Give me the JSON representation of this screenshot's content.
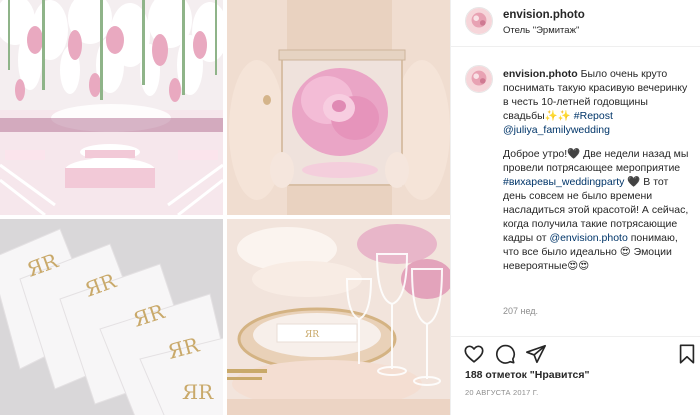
{
  "post": {
    "username": "envision.photo",
    "location": "Отель \"Эрмитаж\""
  },
  "caption": {
    "username": "envision.photo",
    "text_1": "Было очень круто поснимать такую красивую вечеринку в честь 10-летней годовщины свадьбы✨✨ ",
    "repost_tag": "#Repost",
    "mention_1": "@juliya_familywedding",
    "text_2": "Доброе утро!🖤 Две недели назад мы провели потрясающее мероприятие",
    "hashtag": "#вихаревы_weddingparty",
    "text_3": "🖤 В тот день совсем не было времени насладиться этой красотой! А сейчас, когда получила такие потрясающие кадры от",
    "mention_2": "@envision.photo",
    "text_4": "понимаю, что все было идеально 😍 Эмоции невероятные😍😍",
    "age": "207 нед."
  },
  "engagement": {
    "likes": "188 отметок \"Нравится\"",
    "date": "20 АВГУСТА 2017 Г."
  },
  "icons": {
    "like": "heart-outline-icon",
    "comment": "speech-bubble-icon",
    "share": "paper-plane-icon",
    "save": "bookmark-icon"
  },
  "colors": {
    "link": "#003569",
    "muted": "#8e8e8e",
    "text": "#262626",
    "border": "#efefef"
  }
}
